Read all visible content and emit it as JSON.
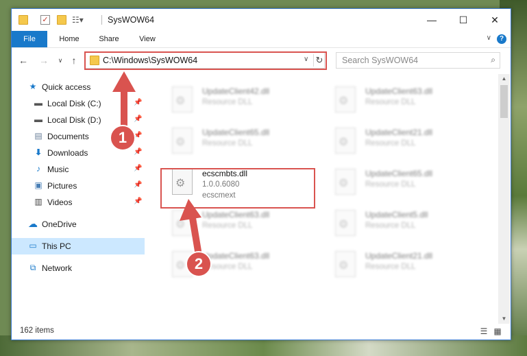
{
  "window": {
    "title": "SysWOW64"
  },
  "title_controls": {
    "minimize": "—",
    "maximize": "☐",
    "close": "✕"
  },
  "ribbon": {
    "tabs": [
      "File",
      "Home",
      "Share",
      "View"
    ],
    "help": "?"
  },
  "address_bar": {
    "path": "C:\\Windows\\SysWOW64"
  },
  "search": {
    "placeholder": "Search SysWOW64"
  },
  "sidebar": {
    "items": [
      {
        "label": "Quick access",
        "icon": "star-icon"
      },
      {
        "label": "Local Disk (C:)",
        "icon": "drive-icon",
        "pinned": true
      },
      {
        "label": "Local Disk (D:)",
        "icon": "drive-icon",
        "pinned": true
      },
      {
        "label": "Documents",
        "icon": "documents-icon",
        "pinned": true
      },
      {
        "label": "Downloads",
        "icon": "download-icon",
        "pinned": true
      },
      {
        "label": "Music",
        "icon": "music-icon",
        "pinned": true
      },
      {
        "label": "Pictures",
        "icon": "pictures-icon",
        "pinned": true
      },
      {
        "label": "Videos",
        "icon": "videos-icon",
        "pinned": true
      },
      {
        "label": "OneDrive",
        "icon": "cloud-icon"
      },
      {
        "label": "This PC",
        "icon": "computer-icon",
        "selected": true
      },
      {
        "label": "Network",
        "icon": "network-icon"
      }
    ]
  },
  "files": {
    "highlighted": {
      "name": "ecscmbts.dll",
      "version": "1.0.0.6080",
      "description": "ecscmext"
    },
    "col1": [
      {
        "name": "UpdateClient42.dll",
        "description": "Resource DLL"
      },
      {
        "name": "UpdateClient65.dll",
        "description": "Resource DLL"
      },
      {
        "name": "UpdateClient63.dll",
        "description": "Resource DLL"
      },
      {
        "name": "UpdateClient63.dll",
        "description": "Resource DLL"
      }
    ],
    "col2": [
      {
        "name": "UpdateClient63.dll",
        "description": "Resource DLL"
      },
      {
        "name": "UpdateClient21.dll",
        "description": "Resource DLL"
      },
      {
        "name": "UpdateClient65.dll",
        "description": "Resource DLL"
      },
      {
        "name": "UpdateClient5.dll",
        "description": "Resource DLL"
      },
      {
        "name": "UpdateClient21.dll",
        "description": "Resource DLL"
      }
    ]
  },
  "status": {
    "item_count": "162 items"
  },
  "callouts": {
    "one": "1",
    "two": "2"
  },
  "colors": {
    "accent": "#1979ca",
    "highlight": "#d9534f",
    "selected": "#cce8ff"
  }
}
